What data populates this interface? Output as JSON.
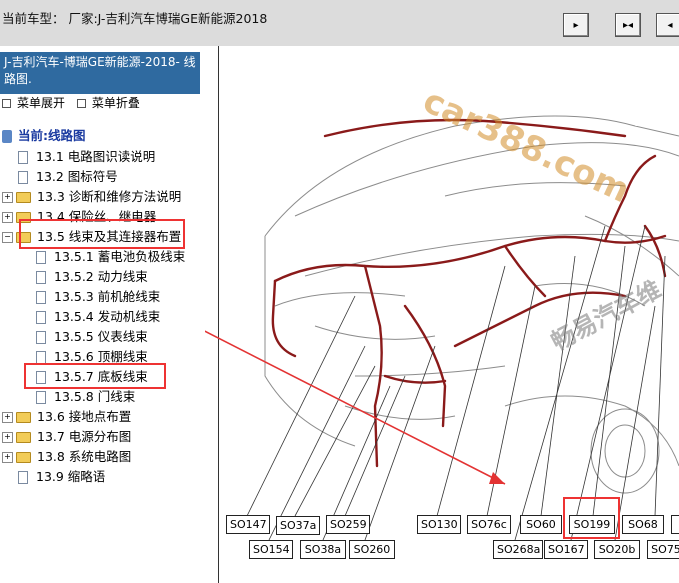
{
  "topbar": {
    "title": "当前车型：  厂家:J-吉利汽车博瑞GE新能源2018",
    "buttons": [
      "▸",
      "▸◂",
      "◂"
    ]
  },
  "sidebar": {
    "heading": "J-吉利汽车-博瑞GE新能源-2018- 线路图.",
    "expand_label": "菜单展开",
    "collapse_label": "菜单折叠",
    "root_label": "当前:线路图",
    "items": [
      {
        "label": "13.1 电路图识读说明"
      },
      {
        "label": "13.2 图标符号"
      },
      {
        "label": "13.3 诊断和维修方法说明"
      },
      {
        "label": "13.4 保险丝、继电器"
      },
      {
        "label": "13.5 线束及其连接器布置"
      },
      {
        "label": "13.5.1 蓄电池负极线束"
      },
      {
        "label": "13.5.2 动力线束"
      },
      {
        "label": "13.5.3 前机舱线束"
      },
      {
        "label": "13.5.4 发动机线束"
      },
      {
        "label": "13.5.5 仪表线束"
      },
      {
        "label": "13.5.6 顶棚线束"
      },
      {
        "label": "13.5.7 底板线束"
      },
      {
        "label": "13.5.8 门线束"
      },
      {
        "label": "13.6 接地点布置"
      },
      {
        "label": "13.7 电源分布图"
      },
      {
        "label": "13.8 系统电路图"
      },
      {
        "label": "13.9 缩略语"
      }
    ]
  },
  "diagram": {
    "watermark_site": "car388.com",
    "watermark_brand": "畅易汽车维",
    "connectors_row1": [
      "SO147",
      "SO37a",
      "SO259",
      "SO130",
      "SO76c",
      "SO60",
      "SO199",
      "SO68"
    ],
    "connectors_row2": [
      "SO154",
      "SO38a",
      "SO260",
      "SO268a",
      "SO167",
      "SO20b",
      "SO75"
    ]
  },
  "colors": {
    "header_bg": "#2f6aa0",
    "highlight": "#e33333",
    "harness": "#8a1a1a"
  }
}
